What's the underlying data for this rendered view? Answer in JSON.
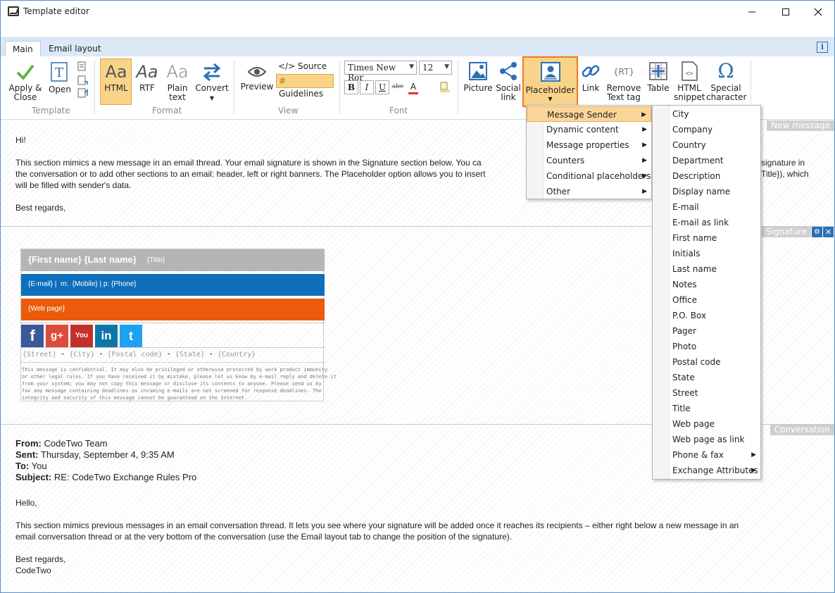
{
  "window": {
    "title": "Template editor"
  },
  "tabs": {
    "main": "Main",
    "email_layout": "Email layout",
    "info": "i"
  },
  "ribbon": {
    "template": {
      "apply_close": [
        "Apply &",
        "Close"
      ],
      "open": "Open",
      "label": "Template"
    },
    "format": {
      "html": "HTML",
      "rtf": "RTF",
      "plain": [
        "Plain",
        "text"
      ],
      "convert": "Convert",
      "label": "Format",
      "aa": "Aa"
    },
    "view": {
      "preview": "Preview",
      "source": "</> Source",
      "guidelines": "Guidelines",
      "label": "View"
    },
    "font": {
      "family": "Times New Ror",
      "size": "12",
      "bold": "B",
      "italic": "I",
      "underline": "U",
      "strike": "abe",
      "color": "A",
      "label": "Font"
    },
    "insert": {
      "picture": "Picture",
      "social": [
        "Social",
        "link"
      ],
      "placeholder": "Placeholder",
      "link": "Link",
      "remove": [
        "Remove",
        "Text tag"
      ],
      "table": "Table",
      "html_snippet": [
        "HTML",
        "snippet"
      ],
      "special": [
        "Special",
        "character"
      ]
    }
  },
  "sections": {
    "new_message": {
      "tag": "New message",
      "greeting": "Hi!",
      "line1": "This section mimics a new message in an email thread. Your email signature is shown in the Signature section below. You ca",
      "line1b": "signature in",
      "line2": "the conversation or to add other sections to an email: header, left or right banners. The Placeholder option allows you to insert",
      "line2b": "Title}), which",
      "line3": "will be filled with sender's data.",
      "closing": "Best regards,"
    },
    "signature": {
      "tag": "Signature",
      "name": "{First name} {Last name}",
      "title": "{Title}",
      "contact": "{E-mail} |  m:  {Mobile} | p: {Phone}",
      "web": "{Web page}",
      "social": {
        "facebook": "f",
        "gplus": "g+",
        "youtube": "You",
        "linkedin": "in",
        "twitter": "t"
      },
      "address": "{Street} • {City} • {Postal code} • {State} • {Country}",
      "disclaimer": [
        "This message is confidential. It may also be privileged or otherwise protected by work product immunity",
        "or other legal rules. If you have received it by mistake, please let us know by e-mail reply and delete it",
        "from your system; you may not copy this message or disclose its contents to anyone. Please send us by",
        "fax any message containing deadlines as incoming e-mails are not screened for response deadlines. The",
        "integrity and security of this message cannot be guaranteed on the Internet."
      ]
    },
    "conversation": {
      "tag": "Conversation",
      "from_label": "From:",
      "from": "CodeTwo Team",
      "sent_label": "Sent:",
      "sent": "Thursday, September 4, 9:35 AM",
      "to_label": "To:",
      "to": "You",
      "subject_label": "Subject:",
      "subject": "RE: CodeTwo Exchange Rules Pro",
      "hello": "Hello,",
      "body1": "This section mimics previous messages in an email conversation thread. It lets you see where your signature will be added once it reaches its recipients – either right below a new message in an",
      "body2": "email conversation thread or at the very bottom of the conversation (use the Email layout tab to change the position of the signature).",
      "closing": "Best regards,",
      "signoff": "CodeTwo"
    }
  },
  "menu_main": [
    "Message Sender",
    "Dynamic content",
    "Message properties",
    "Counters",
    "Conditional placeholders",
    "Other"
  ],
  "menu_sender": [
    "City",
    "Company",
    "Country",
    "Department",
    "Description",
    "Display name",
    "E-mail",
    "E-mail as link",
    "First name",
    "Initials",
    "Last name",
    "Notes",
    "Office",
    "P.O. Box",
    "Pager",
    "Photo",
    "Postal code",
    "State",
    "Street",
    "Title",
    "Web page",
    "Web page as link",
    "Phone & fax",
    "Exchange Attributes"
  ],
  "colors": {
    "accent_orange": "#f07a1a",
    "highlight": "#f9d38a",
    "sig_gray": "#b5b5b5",
    "sig_blue": "#0e6fbd",
    "sig_orange": "#ea5b0c"
  }
}
